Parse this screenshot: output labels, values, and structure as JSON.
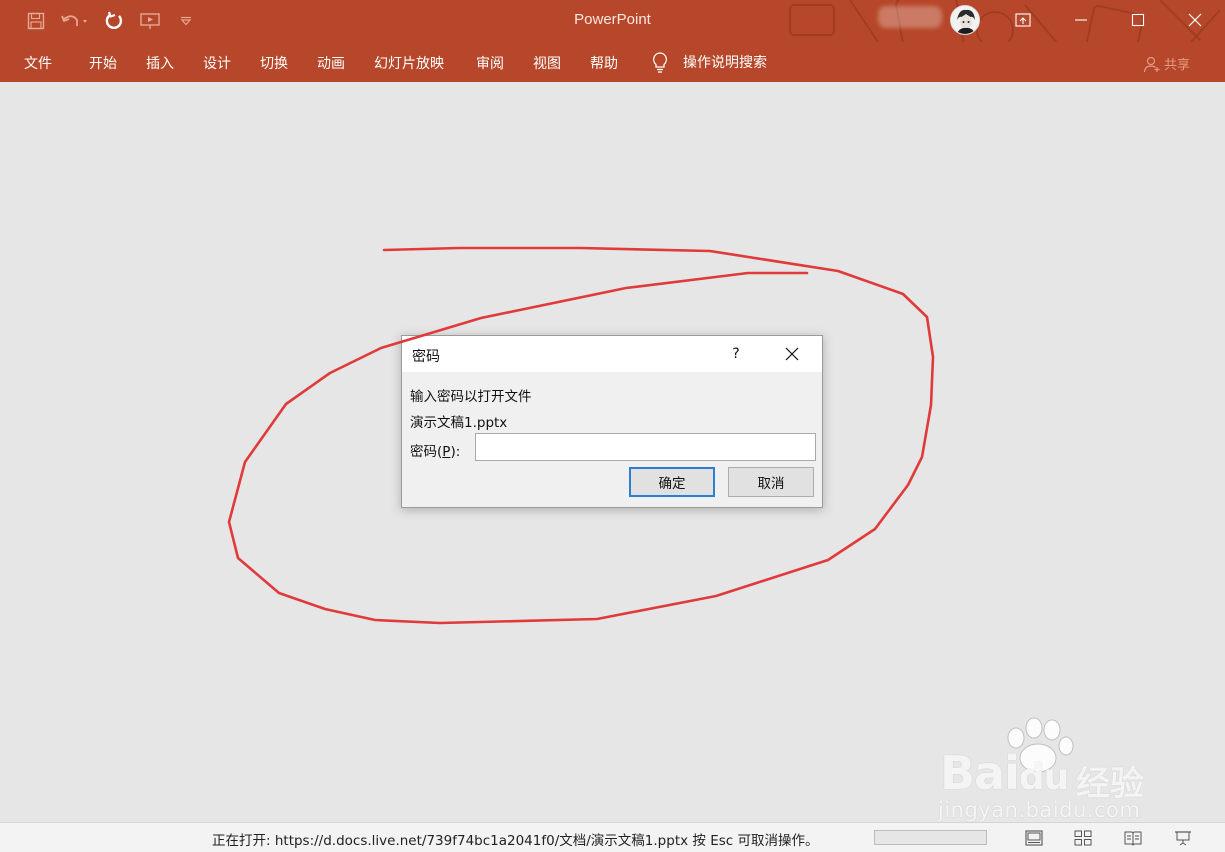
{
  "app": {
    "title": "PowerPoint",
    "accent": "#b7472a"
  },
  "quick_access": [
    {
      "name": "save-icon"
    },
    {
      "name": "undo-icon"
    },
    {
      "name": "redo-icon"
    },
    {
      "name": "present-icon"
    },
    {
      "name": "customize-qat-icon"
    }
  ],
  "ribbon": {
    "tabs": [
      "文件",
      "开始",
      "插入",
      "设计",
      "切换",
      "动画",
      "幻灯片放映",
      "审阅",
      "视图",
      "帮助"
    ],
    "tell_me": "操作说明搜索",
    "share": "共享"
  },
  "dialog": {
    "title": "密码",
    "help": "?",
    "prompt": "输入密码以打开文件",
    "filename": "演示文稿1.pptx",
    "label_prefix": "密码(",
    "label_key": "P",
    "label_suffix": "):",
    "value": "",
    "ok": "确定",
    "cancel": "取消"
  },
  "statusbar": {
    "text": "正在打开: https://d.docs.live.net/739f74bc1a2041f0/文档/演示文稿1.pptx 按 Esc 可取消操作。",
    "progress_fraction": 0.0
  },
  "watermark": {
    "brand": "Bai",
    "brand2": "du",
    "jingyan": "经验",
    "url": "jingyan.baidu.com"
  },
  "colors": {
    "annotation": "#e03a3a",
    "primary_button_border": "#2a7ed4"
  }
}
